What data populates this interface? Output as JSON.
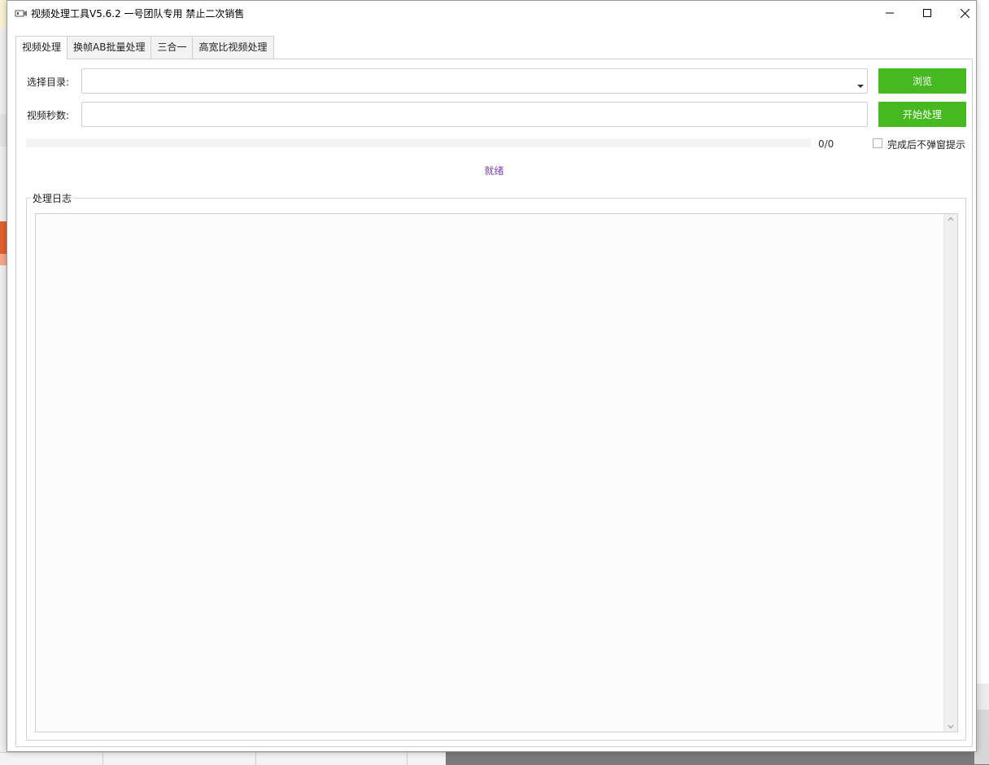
{
  "window": {
    "title": "视频处理工具V5.6.2  一号团队专用  禁止二次销售"
  },
  "tabs": [
    {
      "label": "视频处理",
      "active": true
    },
    {
      "label": "换帧AB批量处理",
      "active": false
    },
    {
      "label": "三合一",
      "active": false
    },
    {
      "label": "高宽比视频处理",
      "active": false
    }
  ],
  "form": {
    "directory_label": "选择目录:",
    "directory_value": "",
    "seconds_label": "视频秒数:",
    "seconds_value": "",
    "browse_label": "浏览",
    "start_label": "开始处理"
  },
  "progress": {
    "value": 0,
    "text": "0/0"
  },
  "options": {
    "no_popup_label": "完成后不弹窗提示",
    "no_popup_checked": false
  },
  "status": {
    "text": "就绪"
  },
  "log": {
    "title": "处理日志",
    "content": ""
  },
  "colors": {
    "accent_green": "#46b820",
    "status_purple": "#7a3fb0"
  },
  "icons": {
    "app": "app-icon",
    "minimize": "minimize-icon",
    "maximize": "maximize-icon",
    "close": "close-icon",
    "dropdown": "chevron-down-icon"
  }
}
